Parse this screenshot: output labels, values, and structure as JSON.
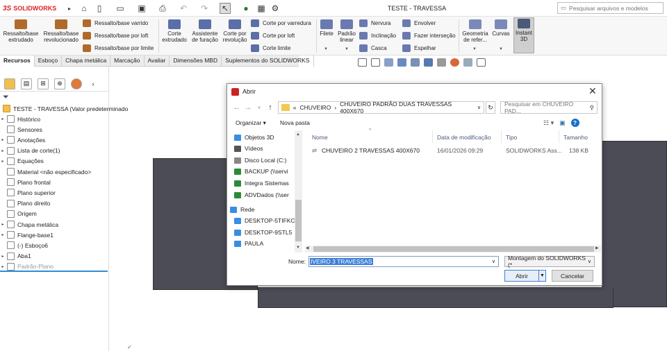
{
  "app": {
    "brand_ds": "3S",
    "brand": "SOLIDWORKS",
    "doc_title": "TESTE - TRAVESSA",
    "search_placeholder": "Pesquisar arquivos e modelos"
  },
  "ribbon": {
    "big": [
      {
        "label": "Ressalto/base extrudado",
        "color": "#b06a2a"
      },
      {
        "label": "Ressalto/base revolucionado",
        "color": "#b06a2a"
      },
      {
        "label": "Corte extrudado",
        "color": "#5a6fa8"
      },
      {
        "label": "Assistente de furação",
        "color": "#5a6fa8"
      },
      {
        "label": "Corte por revolução",
        "color": "#5a6fa8"
      },
      {
        "label": "Filete",
        "color": "#6a7ab0"
      },
      {
        "label": "Padrão linear",
        "color": "#6a7ab0"
      },
      {
        "label": "Geometria de refer...",
        "color": "#7a8ab8"
      },
      {
        "label": "Curvas",
        "color": "#7a8ab8"
      },
      {
        "label": "Instant 3D",
        "color": "#4a5a78"
      }
    ],
    "small": [
      {
        "label": "Ressalto/base varrido",
        "color": "#b06a2a"
      },
      {
        "label": "Ressalto/base por loft",
        "color": "#b06a2a"
      },
      {
        "label": "Ressalto/base por limite",
        "color": "#b06a2a"
      },
      {
        "label": "Corte por varredura",
        "color": "#5a6fa8"
      },
      {
        "label": "Corte por loft",
        "color": "#5a6fa8"
      },
      {
        "label": "Corte limite",
        "color": "#5a6fa8"
      },
      {
        "label": "Nervura",
        "color": "#6a7ab0"
      },
      {
        "label": "Inclinação",
        "color": "#6a7ab0"
      },
      {
        "label": "Casca",
        "color": "#6a7ab0"
      },
      {
        "label": "Envolver",
        "color": "#6a7ab0"
      },
      {
        "label": "Fazer interseção",
        "color": "#6a7ab0"
      },
      {
        "label": "Espelhar",
        "color": "#6a7ab0"
      }
    ]
  },
  "tabs": [
    "Recursos",
    "Esboço",
    "Chapa metálica",
    "Marcação",
    "Avaliar",
    "Dimensões MBD",
    "Suplementos do SOLIDWORKS"
  ],
  "tree": {
    "root": "TESTE - TRAVESSA (Valor predeterminado",
    "items": [
      {
        "label": "Histórico",
        "arrow": "▸",
        "dim": false
      },
      {
        "label": "Sensores",
        "arrow": "",
        "dim": false
      },
      {
        "label": "Anotações",
        "arrow": "▸",
        "dim": false
      },
      {
        "label": "Lista de corte(1)",
        "arrow": "▸",
        "dim": false
      },
      {
        "label": "Equações",
        "arrow": "▸",
        "dim": false
      },
      {
        "label": "Material <não especificado>",
        "arrow": "",
        "dim": false
      },
      {
        "label": "Plano frontal",
        "arrow": "",
        "dim": false
      },
      {
        "label": "Plano superior",
        "arrow": "",
        "dim": false
      },
      {
        "label": "Plano direito",
        "arrow": "",
        "dim": false
      },
      {
        "label": "Origem",
        "arrow": "",
        "dim": false
      },
      {
        "label": "Chapa metálica",
        "arrow": "▸",
        "dim": false
      },
      {
        "label": "Flange-base1",
        "arrow": "▸",
        "dim": false
      },
      {
        "label": "(-) Esboço6",
        "arrow": "",
        "dim": false
      },
      {
        "label": "Aba1",
        "arrow": "▸",
        "dim": false
      },
      {
        "label": "Padrão-Plano",
        "arrow": "▸",
        "dim": true
      }
    ]
  },
  "dialog": {
    "title": "Abrir",
    "path": [
      "«",
      "CHUVEIRO",
      "›",
      "CHUVEIRO PADRÃO DUAS TRAVESSAS 400X670"
    ],
    "search_placeholder": "Pesquisar em CHUVEIRO PAD...",
    "organize": "Organizar ▾",
    "new_folder": "Nova pasta",
    "nav": [
      {
        "label": "Objetos 3D",
        "color": "#3a8ee0"
      },
      {
        "label": "Vídeos",
        "color": "#555"
      },
      {
        "label": "Disco Local (C:)",
        "color": "#888"
      },
      {
        "label": "BACKUP (\\\\servi",
        "color": "#2a8a3a"
      },
      {
        "label": "Integra Sistemas",
        "color": "#2a8a3a"
      },
      {
        "label": "ADVDados (\\\\ser",
        "color": "#2a8a3a"
      },
      {
        "label": "Rede",
        "color": "#3a8ee0"
      },
      {
        "label": "DESKTOP-5TIFKO",
        "color": "#3a8ee0"
      },
      {
        "label": "DESKTOP-9STL5",
        "color": "#3a8ee0"
      },
      {
        "label": "PAULA",
        "color": "#3a8ee0"
      }
    ],
    "columns": [
      "Nome",
      "Data de modificação",
      "Tipo",
      "Tamanho"
    ],
    "files": [
      {
        "name": "CHUVEIRO 2 TRAVESSAS 400X670",
        "date": "16/01/2026 09:29",
        "type": "SOLIDWORKS Ass...",
        "size": "138 KB"
      }
    ],
    "name_label": "Nome:",
    "name_value": "IVEIRO 3 TRAVESSAS",
    "file_type": "Montagem do SOLIDWORKS (*",
    "open_label": "Abrir",
    "cancel_label": "Cancelar"
  }
}
